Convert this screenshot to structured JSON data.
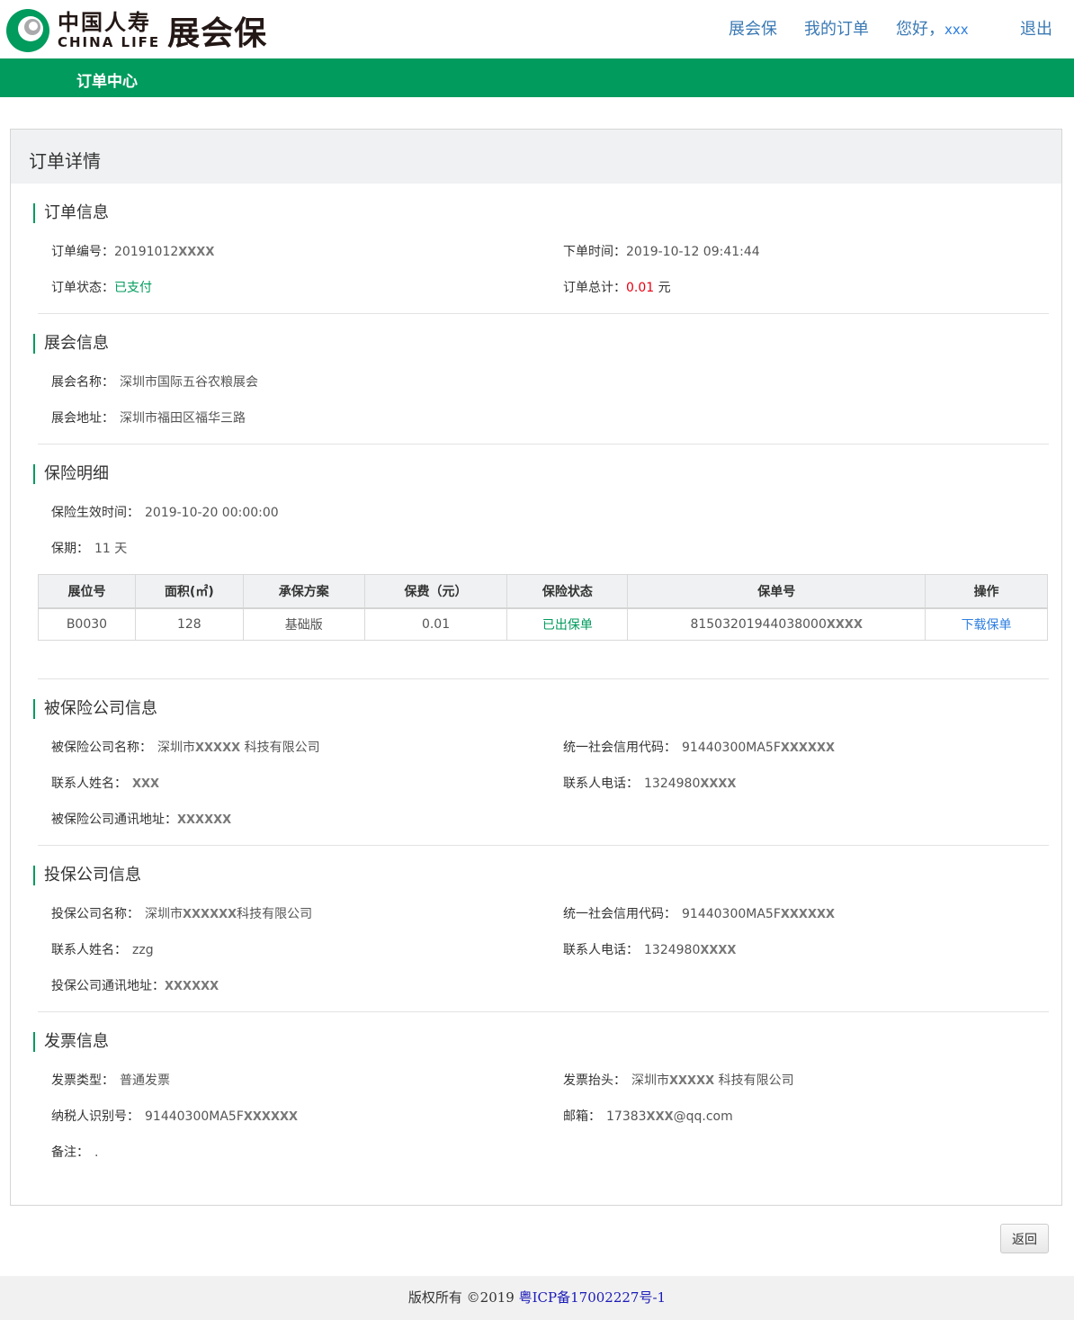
{
  "header": {
    "logo_cn": "中国人寿",
    "logo_en": "CHINA LIFE",
    "product": "展会保",
    "nav": {
      "home": "展会保",
      "orders": "我的订单",
      "greeting": "您好，",
      "username": "xxx",
      "logout": "退出"
    },
    "brand_green": "#009b5d"
  },
  "subnav": {
    "title": "订单中心"
  },
  "panel": {
    "title": "订单详情"
  },
  "order_info": {
    "title": "订单信息",
    "order_no_label": "订单编号：",
    "order_no": "20191012",
    "order_no_mask": "XXXX",
    "order_time_label": "下单时间：",
    "order_time": "2019-10-12 09:41:44",
    "status_label": "订单状态：",
    "status": "已支付",
    "total_label": "订单总计：",
    "total": "0.01",
    "total_unit": "元"
  },
  "expo_info": {
    "title": "展会信息",
    "name_label": "展会名称：",
    "name": "深圳市国际五谷农粮展会",
    "address_label": "展会地址：",
    "address": "深圳市福田区福华三路"
  },
  "insurance": {
    "title": "保险明细",
    "effective_label": "保险生效时间：",
    "effective": "2019-10-20 00:00:00",
    "period_label": "保期：",
    "period": "11 天",
    "columns": [
      "展位号",
      "面积(㎡)",
      "承保方案",
      "保费（元）",
      "保险状态",
      "保单号",
      "操作"
    ],
    "rows": [
      {
        "booth": "B0030",
        "area": "128",
        "plan": "基础版",
        "premium": "0.01",
        "status": "已出保单",
        "policy_no": "81503201944038000",
        "policy_mask": "XXXX",
        "action": "下载保单"
      }
    ]
  },
  "insured_company": {
    "title": "被保险公司信息",
    "name_label": "被保险公司名称：",
    "name_prefix": "深圳市",
    "name_mask": "XXXXX",
    "name_suffix": "科技有限公司",
    "credit_label": "统一社会信用代码：",
    "credit": "91440300MA5F",
    "credit_mask": "XXXXXX",
    "contact_label": "联系人姓名：",
    "contact": "XXX",
    "phone_label": "联系人电话：",
    "phone": "1324980",
    "phone_mask": "XXXX",
    "address_label": "被保险公司通讯地址：",
    "address": "XXXXXX"
  },
  "policyholder_company": {
    "title": "投保公司信息",
    "name_label": "投保公司名称：",
    "name_prefix": "深圳市",
    "name_mask": "XXXXXX",
    "name_suffix": "科技有限公司",
    "credit_label": "统一社会信用代码：",
    "credit": "91440300MA5F",
    "credit_mask": "XXXXXX",
    "contact_label": "联系人姓名：",
    "contact": "zzg",
    "phone_label": "联系人电话：",
    "phone": "1324980",
    "phone_mask": "XXXX",
    "address_label": "投保公司通讯地址：",
    "address": "XXXXXX"
  },
  "invoice": {
    "title": "发票信息",
    "type_label": "发票类型：",
    "type": "普通发票",
    "header_label": "发票抬头：",
    "header_prefix": "深圳市",
    "header_mask": "XXXXX",
    "header_suffix": "科技有限公司",
    "tax_label": "纳税人识别号：",
    "tax": "91440300MA5F",
    "tax_mask": "XXXXXX",
    "email_label": "邮箱：",
    "email_prefix": "17383",
    "email_mask": "XXX",
    "email_suffix": "@qq.com",
    "remark_label": "备注：",
    "remark": "."
  },
  "actions": {
    "back": "返回"
  },
  "footer": {
    "copyright": "版权所有 ©2019 ",
    "icp": "粤ICP备17002227号-1"
  }
}
